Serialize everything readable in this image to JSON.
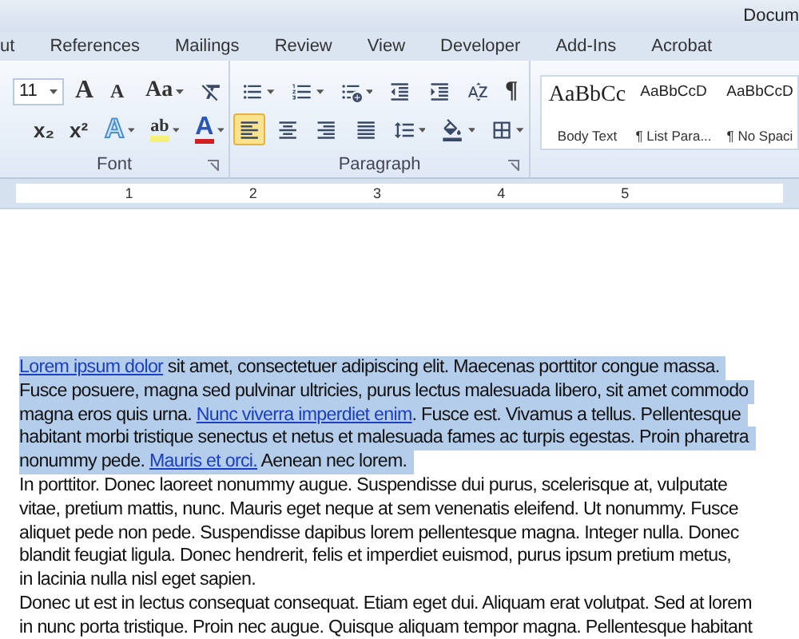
{
  "window": {
    "title": "Docum"
  },
  "tabs": [
    {
      "label": "ut",
      "selected": false
    },
    {
      "label": "References",
      "selected": false
    },
    {
      "label": "Mailings",
      "selected": false
    },
    {
      "label": "Review",
      "selected": false
    },
    {
      "label": "View",
      "selected": false
    },
    {
      "label": "Developer",
      "selected": false
    },
    {
      "label": "Add-Ins",
      "selected": false
    },
    {
      "label": "Acrobat",
      "selected": false
    }
  ],
  "font_group": {
    "label": "Font",
    "size": "11",
    "row1": [
      {
        "kind": "grow",
        "text": "A",
        "has_menu": false
      },
      {
        "kind": "shrink",
        "text": "A",
        "has_menu": false
      },
      {
        "kind": "glyph",
        "text": "Aa",
        "has_menu": true
      },
      {
        "kind": "clear",
        "has_menu": false
      }
    ],
    "row2": [
      {
        "kind": "subscript",
        "text": "x₂",
        "has_menu": false
      },
      {
        "kind": "superscript",
        "text": "x²",
        "has_menu": false
      },
      {
        "kind": "effects",
        "text": "A",
        "has_menu": true
      },
      {
        "kind": "highlight",
        "text": "ab",
        "has_menu": true
      },
      {
        "kind": "color",
        "text": "A",
        "has_menu": true
      }
    ]
  },
  "paragraph_group": {
    "label": "Paragraph",
    "row1": [
      {
        "kind": "bullets",
        "has_menu": true
      },
      {
        "kind": "numbering",
        "has_menu": true
      },
      {
        "kind": "multilevel",
        "has_menu": true
      },
      {
        "kind": "outdent",
        "has_menu": false
      },
      {
        "kind": "indent",
        "has_menu": false
      },
      {
        "kind": "sort",
        "has_menu": false
      },
      {
        "kind": "pilcrow",
        "text": "¶",
        "has_menu": false
      }
    ],
    "align": [
      {
        "kind": "left",
        "selected": true
      },
      {
        "kind": "center",
        "selected": false
      },
      {
        "kind": "right",
        "selected": false
      },
      {
        "kind": "justify",
        "selected": false
      }
    ],
    "row2": [
      {
        "kind": "spacing",
        "has_menu": true
      },
      {
        "kind": "shading",
        "has_menu": true
      },
      {
        "kind": "borders",
        "has_menu": true
      }
    ]
  },
  "styles": [
    {
      "preview": "AaBbCc",
      "name": "Body Text",
      "kind": "serif"
    },
    {
      "preview": "AaBbCcD",
      "name": "¶ List Para...",
      "kind": "sans"
    },
    {
      "preview": "AaBbCcD",
      "name": "¶ No Spaci",
      "kind": "sans"
    }
  ],
  "ruler": {
    "numbers": [
      "1",
      "2",
      "3",
      "4",
      "5"
    ]
  },
  "paragraphs": [
    {
      "selected": true,
      "lines": [
        [
          {
            "kind": "link",
            "text": "Lorem ipsum dolor"
          },
          {
            "kind": "text",
            "text": " sit amet, consectetuer adipiscing elit. Maecenas porttitor congue massa."
          }
        ],
        [
          {
            "kind": "text",
            "text": "Fusce posuere, magna sed pulvinar ultricies, purus lectus malesuada libero, sit amet commodo"
          }
        ],
        [
          {
            "kind": "text",
            "text": "magna eros quis urna. "
          },
          {
            "kind": "link",
            "text": "Nunc viverra imperdiet enim"
          },
          {
            "kind": "text",
            "text": ". Fusce est. Vivamus a tellus. Pellentesque"
          }
        ],
        [
          {
            "kind": "text",
            "text": "habitant morbi tristique senectus et netus et malesuada fames ac turpis egestas. Proin pharetra"
          }
        ],
        [
          {
            "kind": "text",
            "text": "nonummy pede. "
          },
          {
            "kind": "link",
            "text": "Mauris et orci."
          },
          {
            "kind": "text",
            "text": " Aenean nec lorem."
          }
        ]
      ]
    },
    {
      "selected": false,
      "lines": [
        [
          {
            "kind": "text",
            "text": "In porttitor. Donec laoreet nonummy augue. Suspendisse dui purus, scelerisque at, vulputate"
          }
        ],
        [
          {
            "kind": "text",
            "text": "vitae, pretium mattis, nunc. Mauris eget neque at sem venenatis eleifend. Ut nonummy. Fusce"
          }
        ],
        [
          {
            "kind": "text",
            "text": "aliquet pede non pede. Suspendisse dapibus lorem pellentesque magna. Integer nulla. Donec"
          }
        ],
        [
          {
            "kind": "text",
            "text": "blandit feugiat ligula.  Donec hendrerit, felis et imperdiet euismod, purus ipsum pretium metus,"
          }
        ],
        [
          {
            "kind": "text",
            "text": "in lacinia  nulla nisl eget sapien."
          }
        ]
      ]
    },
    {
      "selected": false,
      "lines": [
        [
          {
            "kind": "text",
            "text": "Donec ut est in lectus consequat consequat. Etiam eget dui. Aliquam erat volutpat. Sed at lorem"
          }
        ],
        [
          {
            "kind": "text",
            "text": "in nunc porta tristique. Proin nec augue. Quisque aliquam tempor magna. Pellentesque habitant"
          }
        ]
      ]
    }
  ]
}
